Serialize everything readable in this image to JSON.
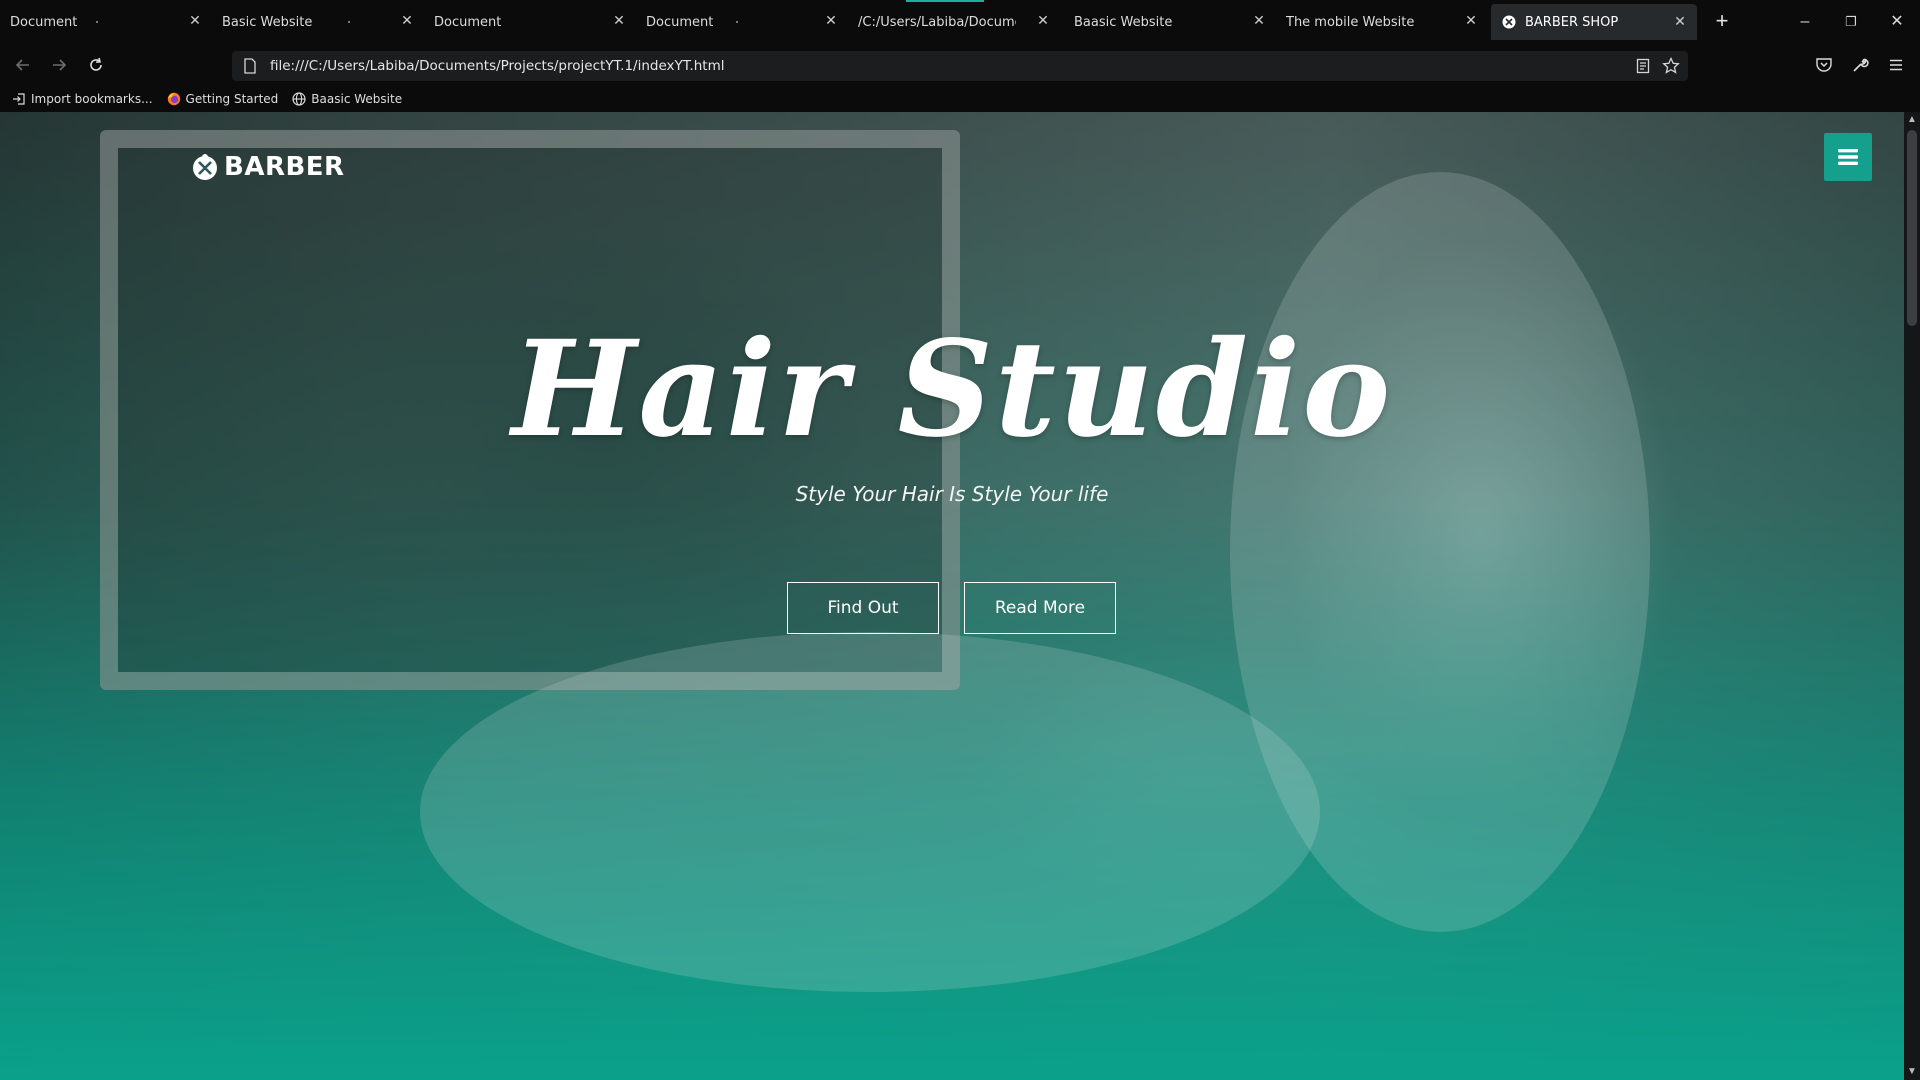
{
  "browser": {
    "tabs": [
      {
        "title": "Document"
      },
      {
        "title": "Basic Website"
      },
      {
        "title": "Document"
      },
      {
        "title": "Document"
      },
      {
        "title": "/C:/Users/Labiba/Documents/Pro"
      },
      {
        "title": "Baasic Website"
      },
      {
        "title": "The mobile Website"
      },
      {
        "title": "BARBER SHOP",
        "active": true
      }
    ],
    "new_tab_label": "+",
    "url": "file:///C:/Users/Labiba/Documents/Projects/projectYT.1/indexYT.html",
    "bookmarks": [
      {
        "label": "Import bookmarks...",
        "icon": "import-icon"
      },
      {
        "label": "Getting Started",
        "icon": "firefox-icon"
      },
      {
        "label": "Baasic Website",
        "icon": "globe-icon"
      }
    ],
    "window_controls": {
      "minimize": "–",
      "restore": "❐",
      "close": "✕"
    }
  },
  "site": {
    "logo_text": "BARBER",
    "hero_title": "Hair Studio",
    "hero_subtitle": "Style Your Hair Is Style Your life",
    "buttons": {
      "find_out": "Find Out",
      "read_more": "Read More"
    },
    "accent_color": "#14a08d"
  }
}
